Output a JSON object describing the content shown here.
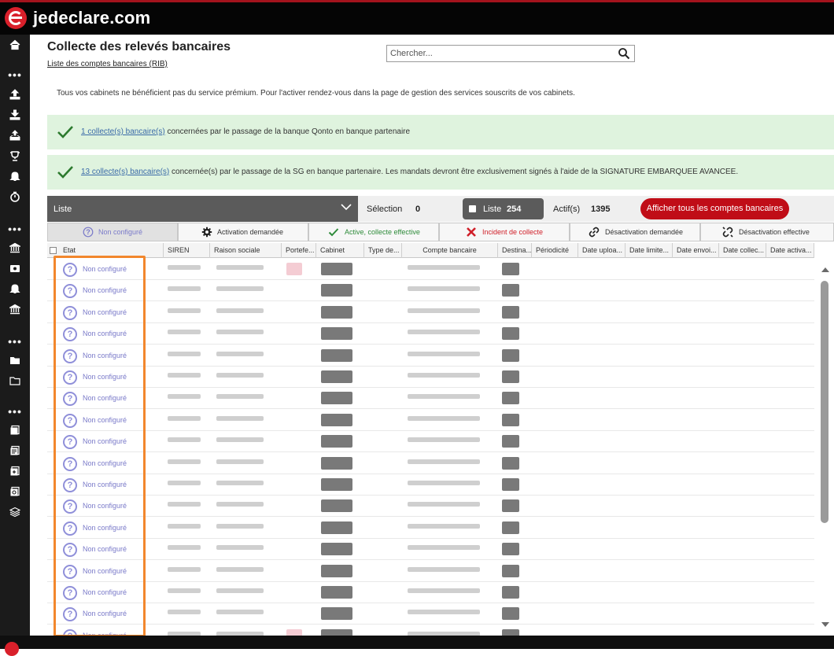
{
  "app": {
    "brand": "jedeclare.com"
  },
  "sidebar": {
    "icons": [
      "home-icon",
      "more-icon",
      "upload-icon",
      "download-icon",
      "sync-icon",
      "trophy-icon",
      "bell-icon",
      "timer-icon",
      "more-icon",
      "bank-icon",
      "card-icon",
      "bell-icon",
      "bank-icon",
      "more-icon",
      "folder-icon",
      "folder-outline-icon",
      "more-icon",
      "document-icon",
      "documents-icon",
      "document-add-icon",
      "document-sync-icon",
      "layers-icon"
    ]
  },
  "header": {
    "title": "Collecte des relevés bancaires",
    "subtitle_link": "Liste des comptes bancaires (RIB)",
    "search_placeholder": "Chercher..."
  },
  "notice": "Tous vos cabinets ne bénéficient pas du service prémium. Pour l'activer rendez-vous dans la page de gestion des services souscrits de vos cabinets.",
  "banners": [
    {
      "link": "1 collecte(s) bancaire(s)",
      "text": " concernées par le passage de la banque Qonto en banque partenaire"
    },
    {
      "link": "13 collecte(s) bancaire(s)",
      "text": " concernée(s) par le passage de la SG en banque partenaire. Les mandats devront être exclusivement signés à l'aide de la SIGNATURE EMBARQUEE AVANCEE."
    }
  ],
  "toolbar": {
    "view": "Liste",
    "selection_label": "Sélection",
    "selection_count": "0",
    "list_label": "Liste",
    "list_count": "254",
    "active_label": "Actif(s)",
    "active_count": "1395",
    "show_all": "Afficher tous les comptes bancaires"
  },
  "tabs": [
    {
      "label": "Non configuré",
      "icon": "question-icon",
      "color": "#7a7ac9"
    },
    {
      "label": "Activation demandée",
      "icon": "gear-icon",
      "color": "#333333"
    },
    {
      "label": "Active, collecte effective",
      "icon": "check-icon",
      "color": "#2e8b3a"
    },
    {
      "label": "Incident de collecte",
      "icon": "cross-icon",
      "color": "#d0202a"
    },
    {
      "label": "Désactivation demandée",
      "icon": "link-icon",
      "color": "#333333"
    },
    {
      "label": "Désactivation effective",
      "icon": "broken-link-icon",
      "color": "#333333"
    }
  ],
  "grid": {
    "columns": [
      "Etat",
      "SIREN",
      "Raison sociale",
      "Portefe...",
      "Cabinet",
      "Type de...",
      "Compte bancaire",
      "Destina...",
      "Périodicité",
      "Date uploa...",
      "Date limite...",
      "Date envoi...",
      "Date collec...",
      "Date activa..."
    ],
    "rows": [
      {
        "etat": "Non configuré"
      },
      {
        "etat": "Non configuré"
      },
      {
        "etat": "Non configuré"
      },
      {
        "etat": "Non configuré"
      },
      {
        "etat": "Non configuré"
      },
      {
        "etat": "Non configuré"
      },
      {
        "etat": "Non configuré"
      },
      {
        "etat": "Non configuré"
      },
      {
        "etat": "Non configuré"
      },
      {
        "etat": "Non configuré"
      },
      {
        "etat": "Non configuré"
      },
      {
        "etat": "Non configuré"
      },
      {
        "etat": "Non configuré"
      },
      {
        "etat": "Non configuré"
      },
      {
        "etat": "Non configuré"
      },
      {
        "etat": "Non configuré"
      },
      {
        "etat": "Non configuré"
      },
      {
        "etat": "Non configuré"
      }
    ]
  },
  "colors": {
    "brand_red": "#c00d17",
    "highlight": "#f2872d",
    "banner_green": "#dff3de",
    "status_purple": "#7a7ac9"
  }
}
